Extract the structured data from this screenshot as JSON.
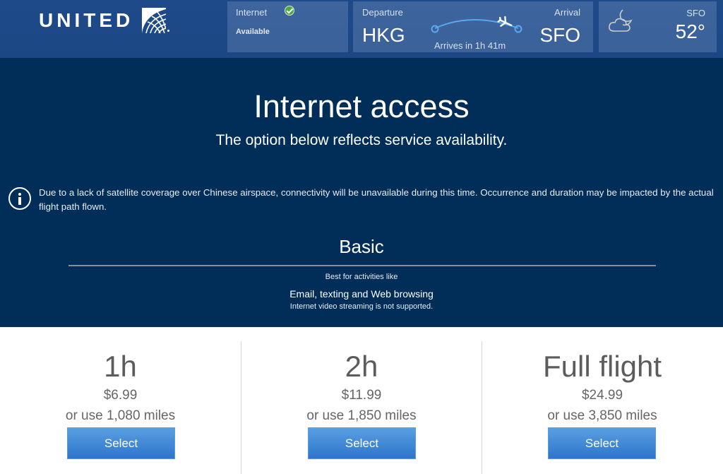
{
  "header": {
    "logo_text": "UNITED",
    "internet": {
      "label": "Internet",
      "status": "Available",
      "status_icon": "check-circle-icon",
      "status_color": "#4caa3f"
    },
    "flight": {
      "departure_label": "Departure",
      "departure_code": "HKG",
      "arrival_label": "Arrival",
      "arrival_code": "SFO",
      "arrives_in": "Arrives in 1h 41m"
    },
    "weather": {
      "icon": "cloud-moon-icon",
      "city": "SFO",
      "temperature": "52°"
    }
  },
  "main": {
    "title": "Internet access",
    "subtitle": "The option below reflects service availability.",
    "notice": "Due to a lack of satellite coverage over Chinese airspace, connectivity will be unavailable during this time. Occurrence and duration may be impacted by the actual flight path flown.",
    "plan": {
      "name": "Basic",
      "best_for_label": "Best for activities like",
      "activities": "Email, texting and Web browsing",
      "restriction": "Internet video streaming is not supported."
    }
  },
  "options": [
    {
      "duration": "1h",
      "price": "$6.99",
      "miles": "or use 1,080 miles",
      "button": "Select"
    },
    {
      "duration": "2h",
      "price": "$11.99",
      "miles": "or use 1,850 miles",
      "button": "Select"
    },
    {
      "duration": "Full flight",
      "price": "$24.99",
      "miles": "or use 3,850 miles",
      "button": "Select"
    }
  ],
  "colors": {
    "header_bg": "#1f4a8a",
    "main_bg": "#002e58",
    "button_blue": "#2f74cc"
  }
}
